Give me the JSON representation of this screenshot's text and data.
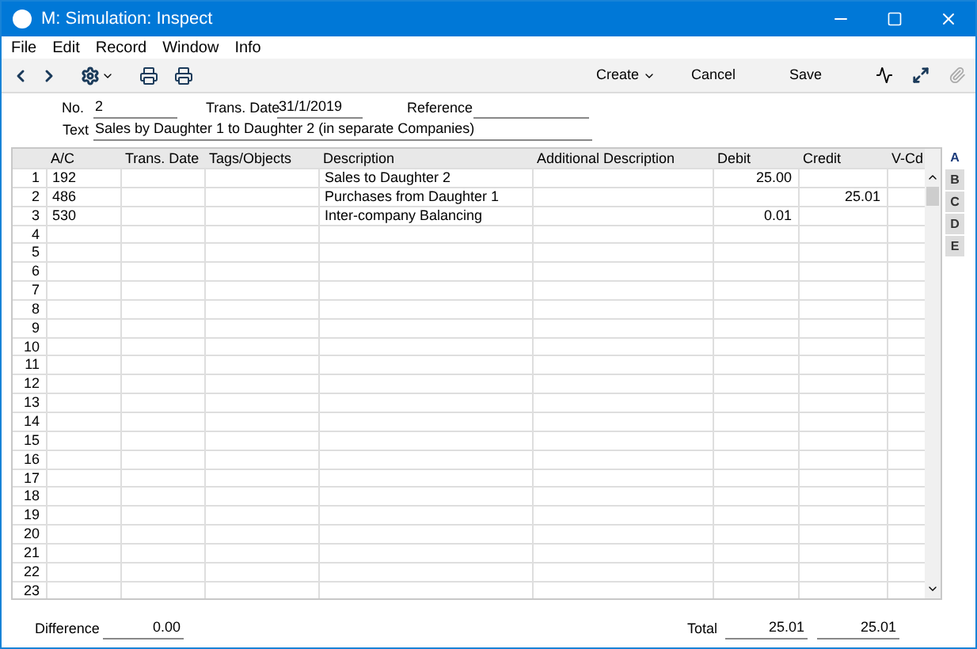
{
  "window": {
    "title": "M: Simulation: Inspect"
  },
  "menu": [
    "File",
    "Edit",
    "Record",
    "Window",
    "Info"
  ],
  "toolbar": {
    "create": "Create",
    "cancel": "Cancel",
    "save": "Save"
  },
  "header": {
    "no_label": "No.",
    "no": "2",
    "date_label": "Trans. Date",
    "date": "31/1/2019",
    "reference_label": "Reference",
    "text_label": "Text",
    "text": "Sales by Daughter 1 to Daughter 2 (in separate Companies)"
  },
  "table": {
    "columns": [
      "A/C",
      "Trans. Date",
      "Tags/Objects",
      "Description",
      "Additional Description",
      "Debit",
      "Credit",
      "V-Cd"
    ],
    "rows": [
      {
        "num": "1",
        "ac": "192",
        "description": "Sales to Daughter 2",
        "debit": "25.00"
      },
      {
        "num": "2",
        "ac": "486",
        "description": "Purchases from Daughter 1",
        "credit": "25.01"
      },
      {
        "num": "3",
        "ac": "530",
        "description": "Inter-company Balancing",
        "debit": "0.01"
      },
      {
        "num": "4"
      },
      {
        "num": "5"
      },
      {
        "num": "6"
      },
      {
        "num": "7"
      },
      {
        "num": "8"
      },
      {
        "num": "9"
      },
      {
        "num": "10"
      },
      {
        "num": "11"
      },
      {
        "num": "12"
      },
      {
        "num": "13"
      },
      {
        "num": "14"
      },
      {
        "num": "15"
      },
      {
        "num": "16"
      },
      {
        "num": "17"
      },
      {
        "num": "18"
      },
      {
        "num": "19"
      },
      {
        "num": "20"
      },
      {
        "num": "21"
      },
      {
        "num": "22"
      },
      {
        "num": "23"
      }
    ]
  },
  "side_tabs": [
    {
      "label": "A",
      "selected": true
    },
    {
      "label": "B",
      "selected": false
    },
    {
      "label": "C",
      "selected": false
    },
    {
      "label": "D",
      "selected": false
    },
    {
      "label": "E",
      "selected": false
    }
  ],
  "footer": {
    "difference_label": "Difference",
    "difference": "0.00",
    "total_label": "Total",
    "total_debit": "25.01",
    "total_credit": "25.01"
  }
}
